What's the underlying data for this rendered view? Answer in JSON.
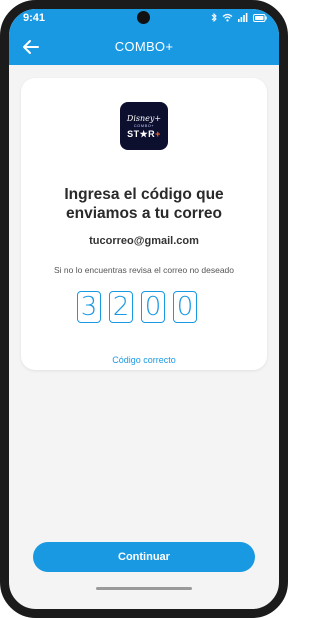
{
  "status_bar": {
    "time": "9:41",
    "icons": [
      "bluetooth-icon",
      "wifi-icon",
      "signal-icon",
      "battery-icon"
    ]
  },
  "header": {
    "title": "COMBO+",
    "back_icon": "arrow-left-icon"
  },
  "app_logo": {
    "line1": "Disney+",
    "line2": "COMBO+",
    "line3_main": "ST★R",
    "line3_plus": "+"
  },
  "verification": {
    "title_line1": "Ingresa el código que",
    "title_line2": "enviamos a tu correo",
    "email": "tucorreo@gmail.com",
    "hint": "Si no lo encuentras revisa el correo no deseado",
    "code_digits": [
      "3",
      "2",
      "0",
      "0"
    ],
    "code_status": "Código correcto"
  },
  "actions": {
    "continue_label": "Continuar"
  },
  "colors": {
    "accent": "#1a99e3",
    "background": "#f4f4f4",
    "card": "#ffffff"
  }
}
